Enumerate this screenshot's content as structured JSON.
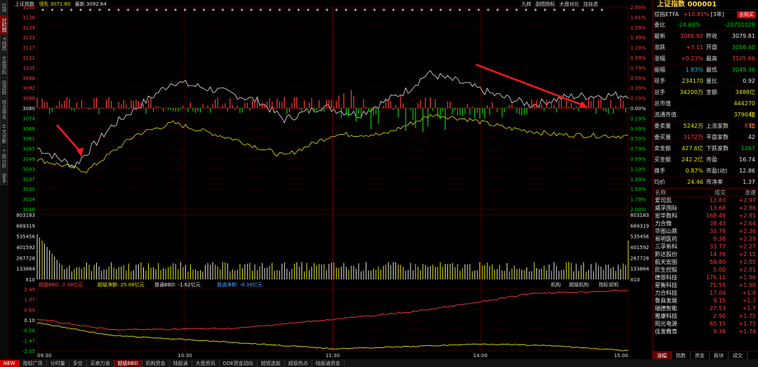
{
  "left_bar": [
    "应用",
    "分时图",
    "K线图",
    "大盘资料",
    "自选股",
    "综合排名",
    "牛叉诊断",
    "个股分析",
    "更多"
  ],
  "header": {
    "name": "上证指数",
    "type_label": "领先",
    "lead_value": "3071.80",
    "latest_label": "最新",
    "latest_value": "3092.64",
    "tools": [
      "九转",
      "副图指标",
      "大盘对比",
      "加自选"
    ]
  },
  "price_axis_left": [
    "3140",
    "3136",
    "3129",
    "3123",
    "3117",
    "3111",
    "3105",
    "3098",
    "3092",
    "3086",
    "3080",
    "3074",
    "3068",
    "3061",
    "3055",
    "3049",
    "3043",
    "3037",
    "3030",
    "3024",
    "3018"
  ],
  "pct_axis_right": [
    "2.00%",
    "1.81%",
    "1.59%",
    "1.39%",
    "1.19%",
    "0.99%",
    "0.79%",
    "0.59%",
    "0.39%",
    "0.19%",
    "0.00%",
    "0.19%",
    "0.39%",
    "0.59%",
    "0.79%",
    "0.99%",
    "1.19%",
    "1.39%",
    "1.59%",
    "1.79%",
    "2.00%"
  ],
  "vol_axis": [
    "803183",
    "669319",
    "535456",
    "401592",
    "267728",
    "133864",
    "X10"
  ],
  "indicator_bar": {
    "items": [
      {
        "label": "超级BBD",
        "value": "2.38亿元",
        "color": "#ff3b3b"
      },
      {
        "label": "超级净额",
        "value": "25.08亿元",
        "color": "#e6e600"
      },
      {
        "label": "普通BBD",
        "value": "-1.62亿元",
        "color": "#e6e6e6"
      },
      {
        "label": "普通净额",
        "value": "-8.39亿元",
        "color": "#4aa0ff"
      }
    ],
    "right": [
      "机构",
      "超级机构",
      "指标说明"
    ]
  },
  "bbd_axis": [
    "2.45",
    "1.07",
    "0.69",
    "0.10",
    "-0.58",
    "-1.47",
    "-2.05"
  ],
  "time_labels": [
    "09:30",
    "10:30",
    "11:30",
    "14:00",
    "15:00"
  ],
  "bottom_tabs": [
    "NEW",
    "指标广场",
    "分时量",
    "多空",
    "买卖力道",
    "超级BBD",
    "机构资金",
    "陆股通",
    "大盘资讯",
    "DDE资金动向",
    "超短选股",
    "超级热点",
    "陆股通资金"
  ],
  "right_panel": {
    "title": "上证指数 000001",
    "etf_label": "综指ETFA",
    "etf_change": "+10.81%",
    "etf_years": "[3年]",
    "etf_btn": "去购买",
    "rows": [
      {
        "l": "委比",
        "v": "-24.60%",
        "vc": "grn",
        "l2": "",
        "v2": "-20701028",
        "v2c": "grn"
      },
      {
        "l": "最新",
        "v": "3086.92",
        "vc": "red",
        "l2": "昨收",
        "v2": "3079.81",
        "v2c": "wht"
      },
      {
        "l": "涨跌",
        "v": "+7.11",
        "vc": "red",
        "l2": "开盘",
        "v2": "3058.40",
        "v2c": "grn"
      },
      {
        "l": "涨幅",
        "v": "+0.23%",
        "vc": "red",
        "l2": "最高",
        "v2": "3105.66",
        "v2c": "red"
      },
      {
        "l": "振幅",
        "v": "1.83%",
        "vc": "cyn",
        "l2": "最低",
        "v2": "3049.36",
        "v2c": "grn"
      },
      {
        "l": "现手",
        "v": "234170",
        "vc": "yel",
        "l2": "量比",
        "v2": "0.92",
        "v2c": "wht"
      },
      {
        "l": "总手",
        "v": "34200万",
        "vc": "yel",
        "l2": "金额",
        "v2": "3488亿",
        "v2c": "yel"
      },
      {
        "l": "总市值",
        "v": "",
        "vc": "wht",
        "l2": "",
        "v2": "444270亿",
        "v2c": "yel"
      },
      {
        "l": "流通市值",
        "v": "",
        "vc": "wht",
        "l2": "",
        "v2": "379046亿",
        "v2c": "yel"
      },
      {
        "l": "委卖量",
        "v": "5242万",
        "vc": "yel",
        "l2": "上涨家数",
        "v2": "816",
        "v2c": "red"
      },
      {
        "l": "委买量",
        "v": "3172万",
        "vc": "red",
        "l2": "平盘家数",
        "v2": "42",
        "v2c": "wht"
      },
      {
        "l": "卖金额",
        "v": "427.6亿",
        "vc": "yel",
        "l2": "下跌家数",
        "v2": "1267",
        "v2c": "grn"
      },
      {
        "l": "买金额",
        "v": "242.2亿",
        "vc": "yel",
        "l2": "市盈",
        "v2": "16.74",
        "v2c": "wht"
      },
      {
        "l": "换手",
        "v": "0.87%",
        "vc": "yel",
        "l2": "市盈(动)",
        "v2": "12.86",
        "v2c": "wht"
      },
      {
        "l": "均价",
        "v": "24.46",
        "vc": "yel",
        "l2": "市净率",
        "v2": "1.37",
        "v2c": "wht"
      }
    ],
    "list_headers": [
      "名称",
      "成交",
      "涨速"
    ],
    "stocks": [
      {
        "n": "爱司凯",
        "p": "12.83",
        "c": "+2.97"
      },
      {
        "n": "威孚国际",
        "p": "13.68",
        "c": "+2.86"
      },
      {
        "n": "宏华数科",
        "p": "168.49",
        "c": "+2.81"
      },
      {
        "n": "力合微",
        "p": "38.43",
        "c": "+2.64"
      },
      {
        "n": "华图山鼎",
        "p": "33.78",
        "c": "+2.36"
      },
      {
        "n": "易明医药",
        "p": "9.38",
        "c": "+2.29"
      },
      {
        "n": "三孚新科",
        "p": "33.77",
        "c": "+2.27"
      },
      {
        "n": "黔达股份",
        "p": "14.76",
        "c": "+2.15"
      },
      {
        "n": "航天宏图",
        "p": "59.80",
        "c": "+2.05"
      },
      {
        "n": "民生控股",
        "p": "5.00",
        "c": "+2.01"
      },
      {
        "n": "德恩科技",
        "p": "176.11",
        "c": "+1.96"
      },
      {
        "n": "星衡科技",
        "p": "75.55",
        "c": "+1.90"
      },
      {
        "n": "力合科技",
        "p": "17.04",
        "c": "+1.8"
      },
      {
        "n": "鲁商发展",
        "p": "9.15",
        "c": "+1.7"
      },
      {
        "n": "瑞德智能",
        "p": "27.53",
        "c": "+1.7"
      },
      {
        "n": "雅康科技",
        "p": "2.90",
        "c": "+1.75"
      },
      {
        "n": "阳光电源",
        "p": "65.15",
        "c": "+1.75"
      },
      {
        "n": "佳发教育",
        "p": "9.38",
        "c": "+1.74"
      }
    ],
    "bottom_tabs": [
      "涨幅",
      "指数",
      "资金",
      "板块",
      "成交"
    ]
  },
  "colors": {
    "up": "#ff3b3b",
    "down": "#00d000",
    "price_line": "#e6e6e6",
    "avg_line": "#e6e600",
    "grid": "#3a0000",
    "mid": "#a00000"
  }
}
